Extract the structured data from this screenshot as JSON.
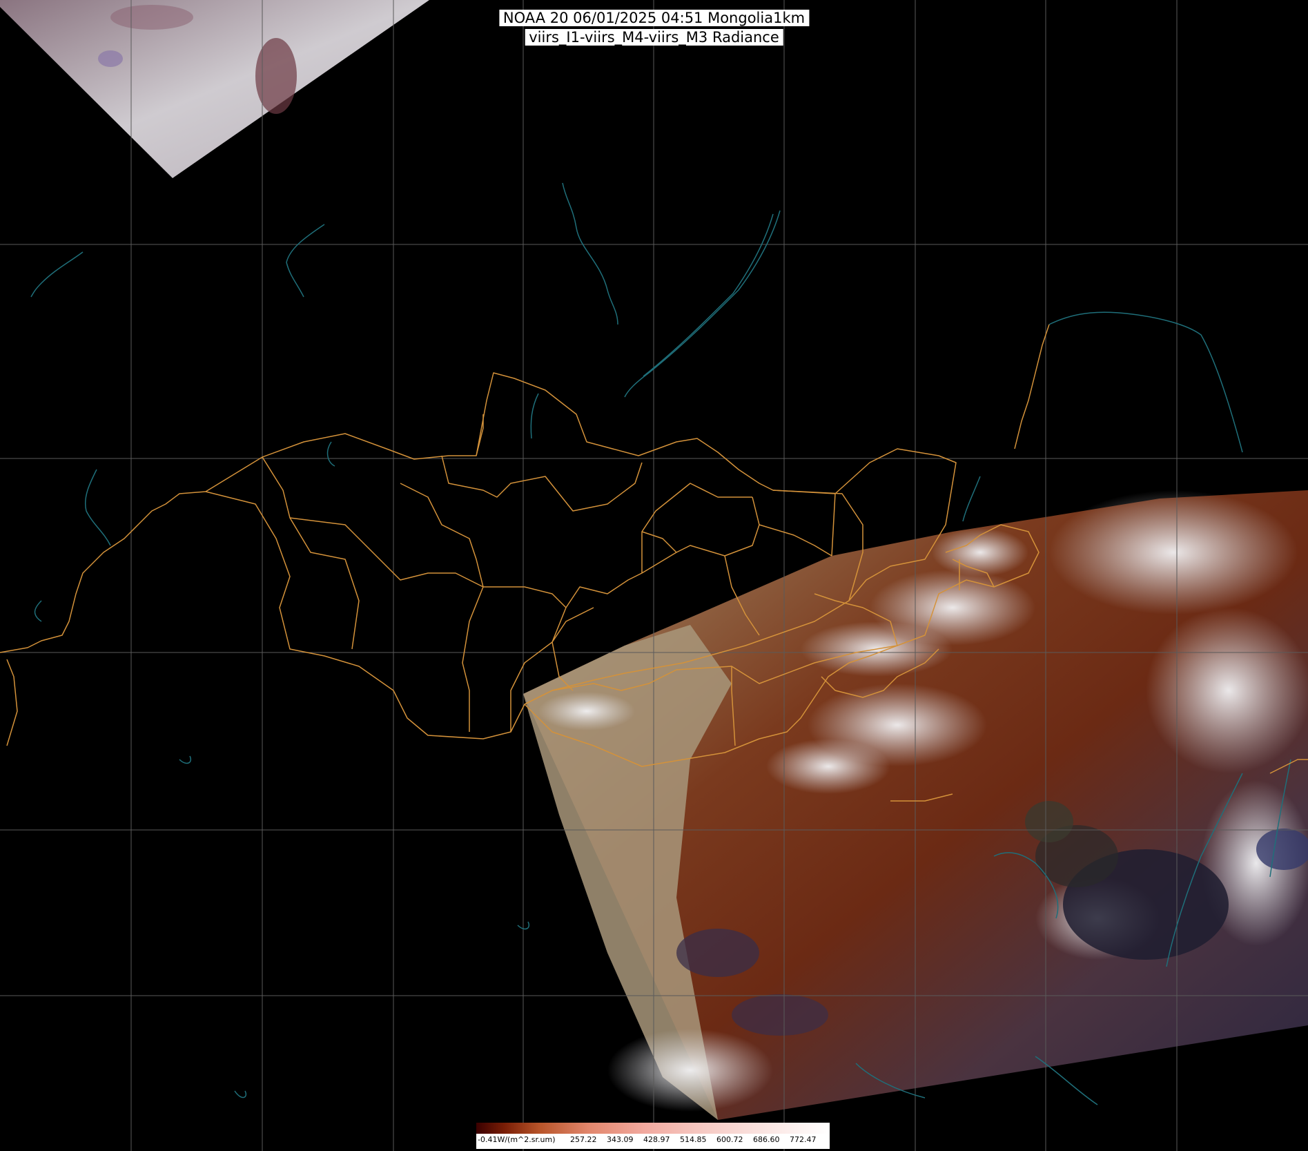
{
  "header": {
    "title_line1": "NOAA 20 06/01/2025 04:51 Mongolia1km",
    "title_line2": "viirs_I1-viirs_M4-viirs_M3 Radiance"
  },
  "colorbar": {
    "unit_label": "-0.41W/(m^2.sr.um)",
    "ticks": [
      "257.22",
      "343.09",
      "428.97",
      "514.85",
      "600.72",
      "686.60",
      "772.47"
    ],
    "colors": [
      "#3a0000",
      "#7a1e06",
      "#b8552a",
      "#e2876d",
      "#f2aaa0",
      "#f6c9c3",
      "#fae2df",
      "#ffffff"
    ]
  },
  "map_colors": {
    "background": "#000000",
    "grid": "#5a5a5a",
    "admin_borders": "#d4923a",
    "coastlines_lakes": "#1f6f7a",
    "cloud": "#e6e6ea",
    "land_brown": "#7a3a1e",
    "land_tan": "#a8926e",
    "sea_dark": "#1e1d30"
  }
}
